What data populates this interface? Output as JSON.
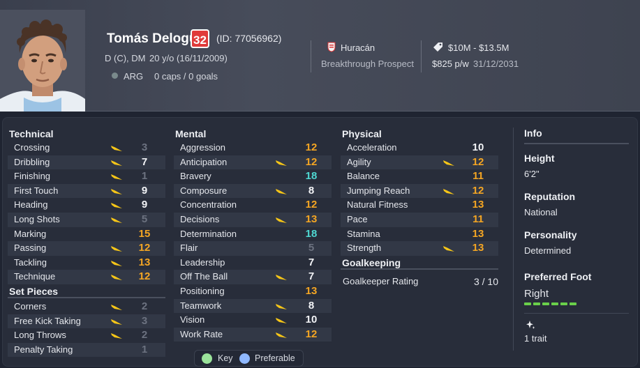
{
  "player": {
    "name": "Tomás Delogu",
    "ability": "32",
    "id_text": "(ID: 77056962)",
    "positions": "D (C), DM",
    "age": "20 y/o (16/11/2009)",
    "nation": "ARG",
    "caps": "0 caps / 0 goals",
    "club": "Huracán",
    "status": "Breakthrough Prospect",
    "value": "$10M - $13.5M",
    "wage": "$825 p/w",
    "contract_end": "31/12/2031"
  },
  "colors": {
    "dim": "#6c7280",
    "white": "#f2f3f6",
    "orange": "#f5a623",
    "cyan": "#4fd8d2",
    "arrow": "#f5c518",
    "badge": "#e03a3a",
    "foot_bar": "#6ad04a",
    "key_dot": "#9be39b",
    "preferable_dot": "#8fb8ff"
  },
  "technical": {
    "title": "Technical",
    "rows": [
      {
        "name": "Crossing",
        "value": "3",
        "tone": "dim",
        "arrow": true
      },
      {
        "name": "Dribbling",
        "value": "7",
        "tone": "white",
        "arrow": true
      },
      {
        "name": "Finishing",
        "value": "1",
        "tone": "dim",
        "arrow": true
      },
      {
        "name": "First Touch",
        "value": "9",
        "tone": "white",
        "arrow": true
      },
      {
        "name": "Heading",
        "value": "9",
        "tone": "white",
        "arrow": true
      },
      {
        "name": "Long Shots",
        "value": "5",
        "tone": "dim",
        "arrow": true
      },
      {
        "name": "Marking",
        "value": "15",
        "tone": "orange",
        "arrow": false
      },
      {
        "name": "Passing",
        "value": "12",
        "tone": "orange",
        "arrow": true
      },
      {
        "name": "Tackling",
        "value": "13",
        "tone": "orange",
        "arrow": true
      },
      {
        "name": "Technique",
        "value": "12",
        "tone": "orange",
        "arrow": true
      }
    ]
  },
  "set_pieces": {
    "title": "Set Pieces",
    "rows": [
      {
        "name": "Corners",
        "value": "2",
        "tone": "dim",
        "arrow": true
      },
      {
        "name": "Free Kick Taking",
        "value": "3",
        "tone": "dim",
        "arrow": true
      },
      {
        "name": "Long Throws",
        "value": "2",
        "tone": "dim",
        "arrow": true
      },
      {
        "name": "Penalty Taking",
        "value": "1",
        "tone": "dim",
        "arrow": false
      }
    ]
  },
  "mental": {
    "title": "Mental",
    "rows": [
      {
        "name": "Aggression",
        "value": "12",
        "tone": "orange",
        "arrow": false
      },
      {
        "name": "Anticipation",
        "value": "12",
        "tone": "orange",
        "arrow": true
      },
      {
        "name": "Bravery",
        "value": "18",
        "tone": "cyan",
        "arrow": false
      },
      {
        "name": "Composure",
        "value": "8",
        "tone": "white",
        "arrow": true
      },
      {
        "name": "Concentration",
        "value": "12",
        "tone": "orange",
        "arrow": false
      },
      {
        "name": "Decisions",
        "value": "13",
        "tone": "orange",
        "arrow": true
      },
      {
        "name": "Determination",
        "value": "18",
        "tone": "cyan",
        "arrow": false
      },
      {
        "name": "Flair",
        "value": "5",
        "tone": "dim",
        "arrow": false
      },
      {
        "name": "Leadership",
        "value": "7",
        "tone": "white",
        "arrow": false
      },
      {
        "name": "Off The Ball",
        "value": "7",
        "tone": "white",
        "arrow": true
      },
      {
        "name": "Positioning",
        "value": "13",
        "tone": "orange",
        "arrow": false
      },
      {
        "name": "Teamwork",
        "value": "8",
        "tone": "white",
        "arrow": true
      },
      {
        "name": "Vision",
        "value": "10",
        "tone": "white",
        "arrow": true
      },
      {
        "name": "Work Rate",
        "value": "12",
        "tone": "orange",
        "arrow": true
      }
    ]
  },
  "physical": {
    "title": "Physical",
    "rows": [
      {
        "name": "Acceleration",
        "value": "10",
        "tone": "white",
        "arrow": false
      },
      {
        "name": "Agility",
        "value": "12",
        "tone": "orange",
        "arrow": true
      },
      {
        "name": "Balance",
        "value": "11",
        "tone": "orange",
        "arrow": false
      },
      {
        "name": "Jumping Reach",
        "value": "12",
        "tone": "orange",
        "arrow": true
      },
      {
        "name": "Natural Fitness",
        "value": "13",
        "tone": "orange",
        "arrow": false
      },
      {
        "name": "Pace",
        "value": "11",
        "tone": "orange",
        "arrow": false
      },
      {
        "name": "Stamina",
        "value": "13",
        "tone": "orange",
        "arrow": false
      },
      {
        "name": "Strength",
        "value": "13",
        "tone": "orange",
        "arrow": true
      }
    ]
  },
  "goalkeeping": {
    "title": "Goalkeeping",
    "label": "Goalkeeper Rating",
    "value": "3 / 10"
  },
  "info": {
    "title": "Info",
    "height_label": "Height",
    "height": "6'2\"",
    "reputation_label": "Reputation",
    "reputation": "National",
    "personality_label": "Personality",
    "personality": "Determined",
    "foot_label": "Preferred Foot",
    "foot": "Right",
    "foot_level_of_6": 6,
    "traits": "1 trait"
  },
  "legend": {
    "key": "Key",
    "preferable": "Preferable"
  },
  "icons": {
    "nation": "flag-icon",
    "club": "club-crest-icon",
    "value": "price-tag-icon",
    "arrow": "preferred-arrow-icon",
    "trait": "sparkle-icon"
  }
}
